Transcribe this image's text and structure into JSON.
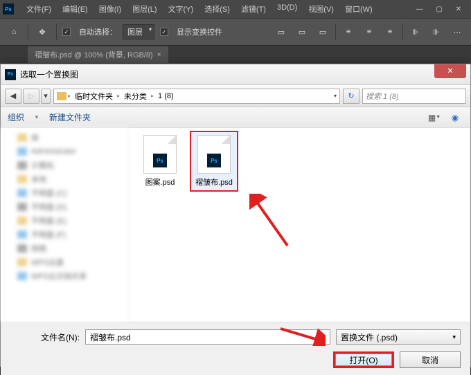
{
  "menu": [
    "文件(F)",
    "编辑(E)",
    "图像(I)",
    "图层(L)",
    "文字(Y)",
    "选择(S)",
    "滤镜(T)",
    "3D(D)",
    "视图(V)",
    "窗口(W)"
  ],
  "toolbar": {
    "auto_select": "自动选择：",
    "layer": "图层",
    "show_transform": "显示变换控件"
  },
  "doc_tab": "褶皱布.psd @ 100% (背景, RGB/8)",
  "dialog": {
    "title": "选取一个置换图",
    "breadcrumb": [
      "临时文件夹",
      "未分类",
      "1 (8)"
    ],
    "search_placeholder": "搜索 1 (8)",
    "organize": "组织",
    "new_folder": "新建文件夹",
    "files": [
      {
        "name": "图案.psd",
        "selected": false
      },
      {
        "name": "褶皱布.psd",
        "selected": true
      }
    ],
    "filename_label": "文件名(N):",
    "filename_value": "褶皱布.psd",
    "filter": "置换文件 (.psd)",
    "open": "打开(O)",
    "cancel": "取消"
  },
  "sidebar_items": [
    "库",
    "Administrator",
    "计算机",
    "本地",
    "不明盘 (C)",
    "不明盘 (D)",
    "不明盘 (E)",
    "不明盘 (F)",
    "网络",
    "WPS云盘",
    "WPS云文档共享"
  ]
}
